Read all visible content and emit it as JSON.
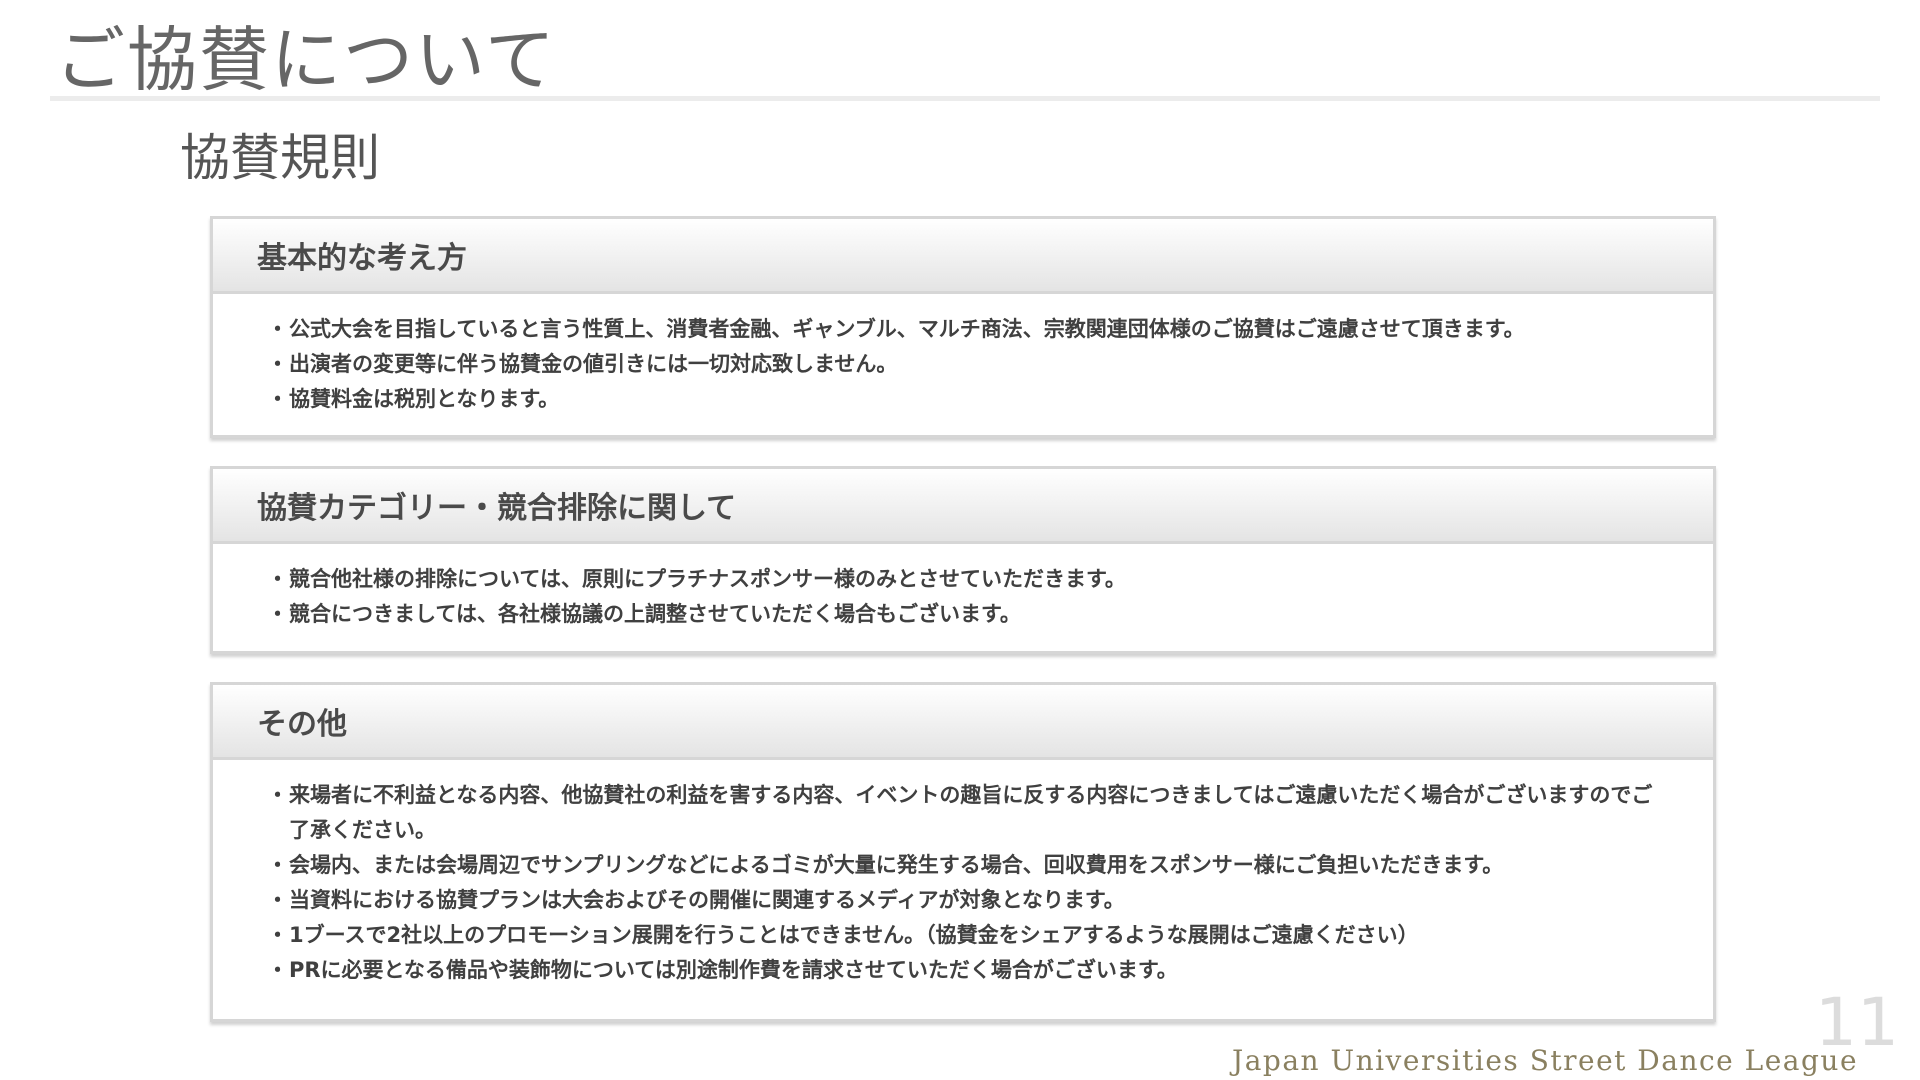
{
  "page": {
    "title": "ご協賛について",
    "section_title": "協賛規則",
    "page_number": "11",
    "footer": "Japan Universities Street Dance League"
  },
  "bullet_glyph": "・",
  "cards": [
    {
      "heading": "基本的な考え方",
      "items": [
        "公式大会を目指していると言う性質上、消費者金融、ギャンブル、マルチ商法、宗教関連団体様のご協賛はご遠慮させて頂きます。",
        "出演者の変更等に伴う協賛金の値引きには一切対応致しません。",
        "協賛料金は税別となります。"
      ]
    },
    {
      "heading": "協賛カテゴリー・競合排除に関して",
      "items": [
        "競合他社様の排除については、原則にプラチナスポンサー様のみとさせていただきます。",
        "競合につきましては、各社様協議の上調整させていただく場合もございます。"
      ]
    },
    {
      "heading": "その他",
      "items": [
        "来場者に不利益となる内容、他協賛社の利益を害する内容、イベントの趣旨に反する内容につきましてはご遠慮いただく場合がございますのでご了承ください。",
        "会場内、または会場周辺でサンプリングなどによるゴミが大量に発生する場合、回収費用をスポンサー様にご負担いただきます。",
        "当資料における協賛プランは大会およびその開催に関連するメディアが対象となります。",
        "1ブースで2社以上のプロモーション展開を行うことはできません。（協賛金をシェアするような展開はご遠慮ください）",
        "PRに必要となる備品や装飾物については別途制作費を請求させていただく場合がございます。"
      ]
    }
  ]
}
